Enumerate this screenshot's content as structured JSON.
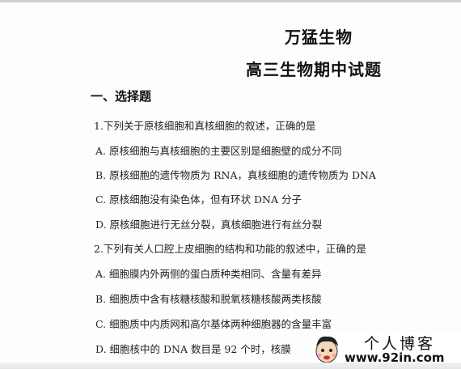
{
  "header": {
    "school": "万猛生物",
    "title": "高三生物期中试题"
  },
  "section": {
    "heading": "一、选择题"
  },
  "questions": [
    {
      "stem": "1.下列关于原核细胞和真核细胞的叙述，正确的是",
      "options": [
        "A.  原核细胞与真核细胞的主要区别是细胞壁的成分不同",
        "B.  原核细胞的遗传物质为 RNA，真核细胞的遗传物质为 DNA",
        "C.  原核细胞没有染色体，但有环状 DNA 分子",
        "D.  原核细胞进行无丝分裂，真核细胞进行有丝分裂"
      ]
    },
    {
      "stem": "2.下列有关人口腔上皮细胞的结构和功能的叙述中，正确的是",
      "options": [
        "A.  细胞膜内外两侧的蛋白质种类相同、含量有差异",
        "B.  细胞质中含有核糖核酸和脱氧核糖核酸两类核酸",
        "C.  细胞质中内质网和高尔基体两种细胞器的含量丰富",
        "D.  细胞核中的 DNA 数目是 92 个时，核膜"
      ]
    }
  ],
  "watermark": {
    "title": "个人博客",
    "url": "www.92in.com",
    "avatar_icon": "cartoon-face-icon"
  }
}
